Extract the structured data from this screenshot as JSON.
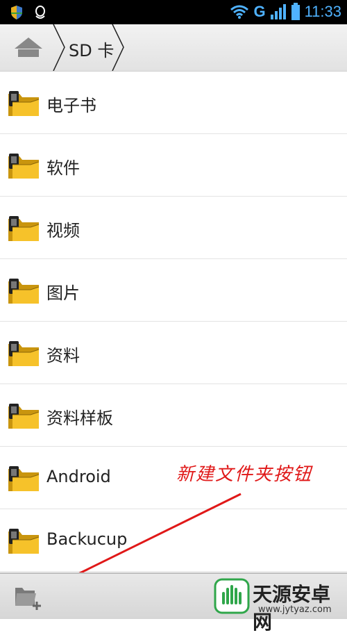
{
  "status_bar": {
    "time": "11:33",
    "network_type": "G",
    "icons": [
      "shield-icon",
      "qq-icon",
      "wifi-icon",
      "signal-icon",
      "battery-icon"
    ]
  },
  "breadcrumb": {
    "home_icon": "home-icon",
    "current": "SD 卡"
  },
  "folders": [
    {
      "name": "电子书"
    },
    {
      "name": "软件"
    },
    {
      "name": "视频"
    },
    {
      "name": "图片"
    },
    {
      "name": "资料"
    },
    {
      "name": "资料样板"
    },
    {
      "name": "Android"
    },
    {
      "name": "Backucup"
    }
  ],
  "bottom_bar": {
    "new_folder_icon": "new-folder-icon"
  },
  "annotation": {
    "text": "新建文件夹按钮",
    "color": "#e01818"
  },
  "watermark": {
    "title": "天源安卓网",
    "url": "www.jytyaz.com"
  },
  "colors": {
    "accent": "#4fb2ff",
    "folder": "#f6c22a",
    "annotation": "#e01818"
  }
}
